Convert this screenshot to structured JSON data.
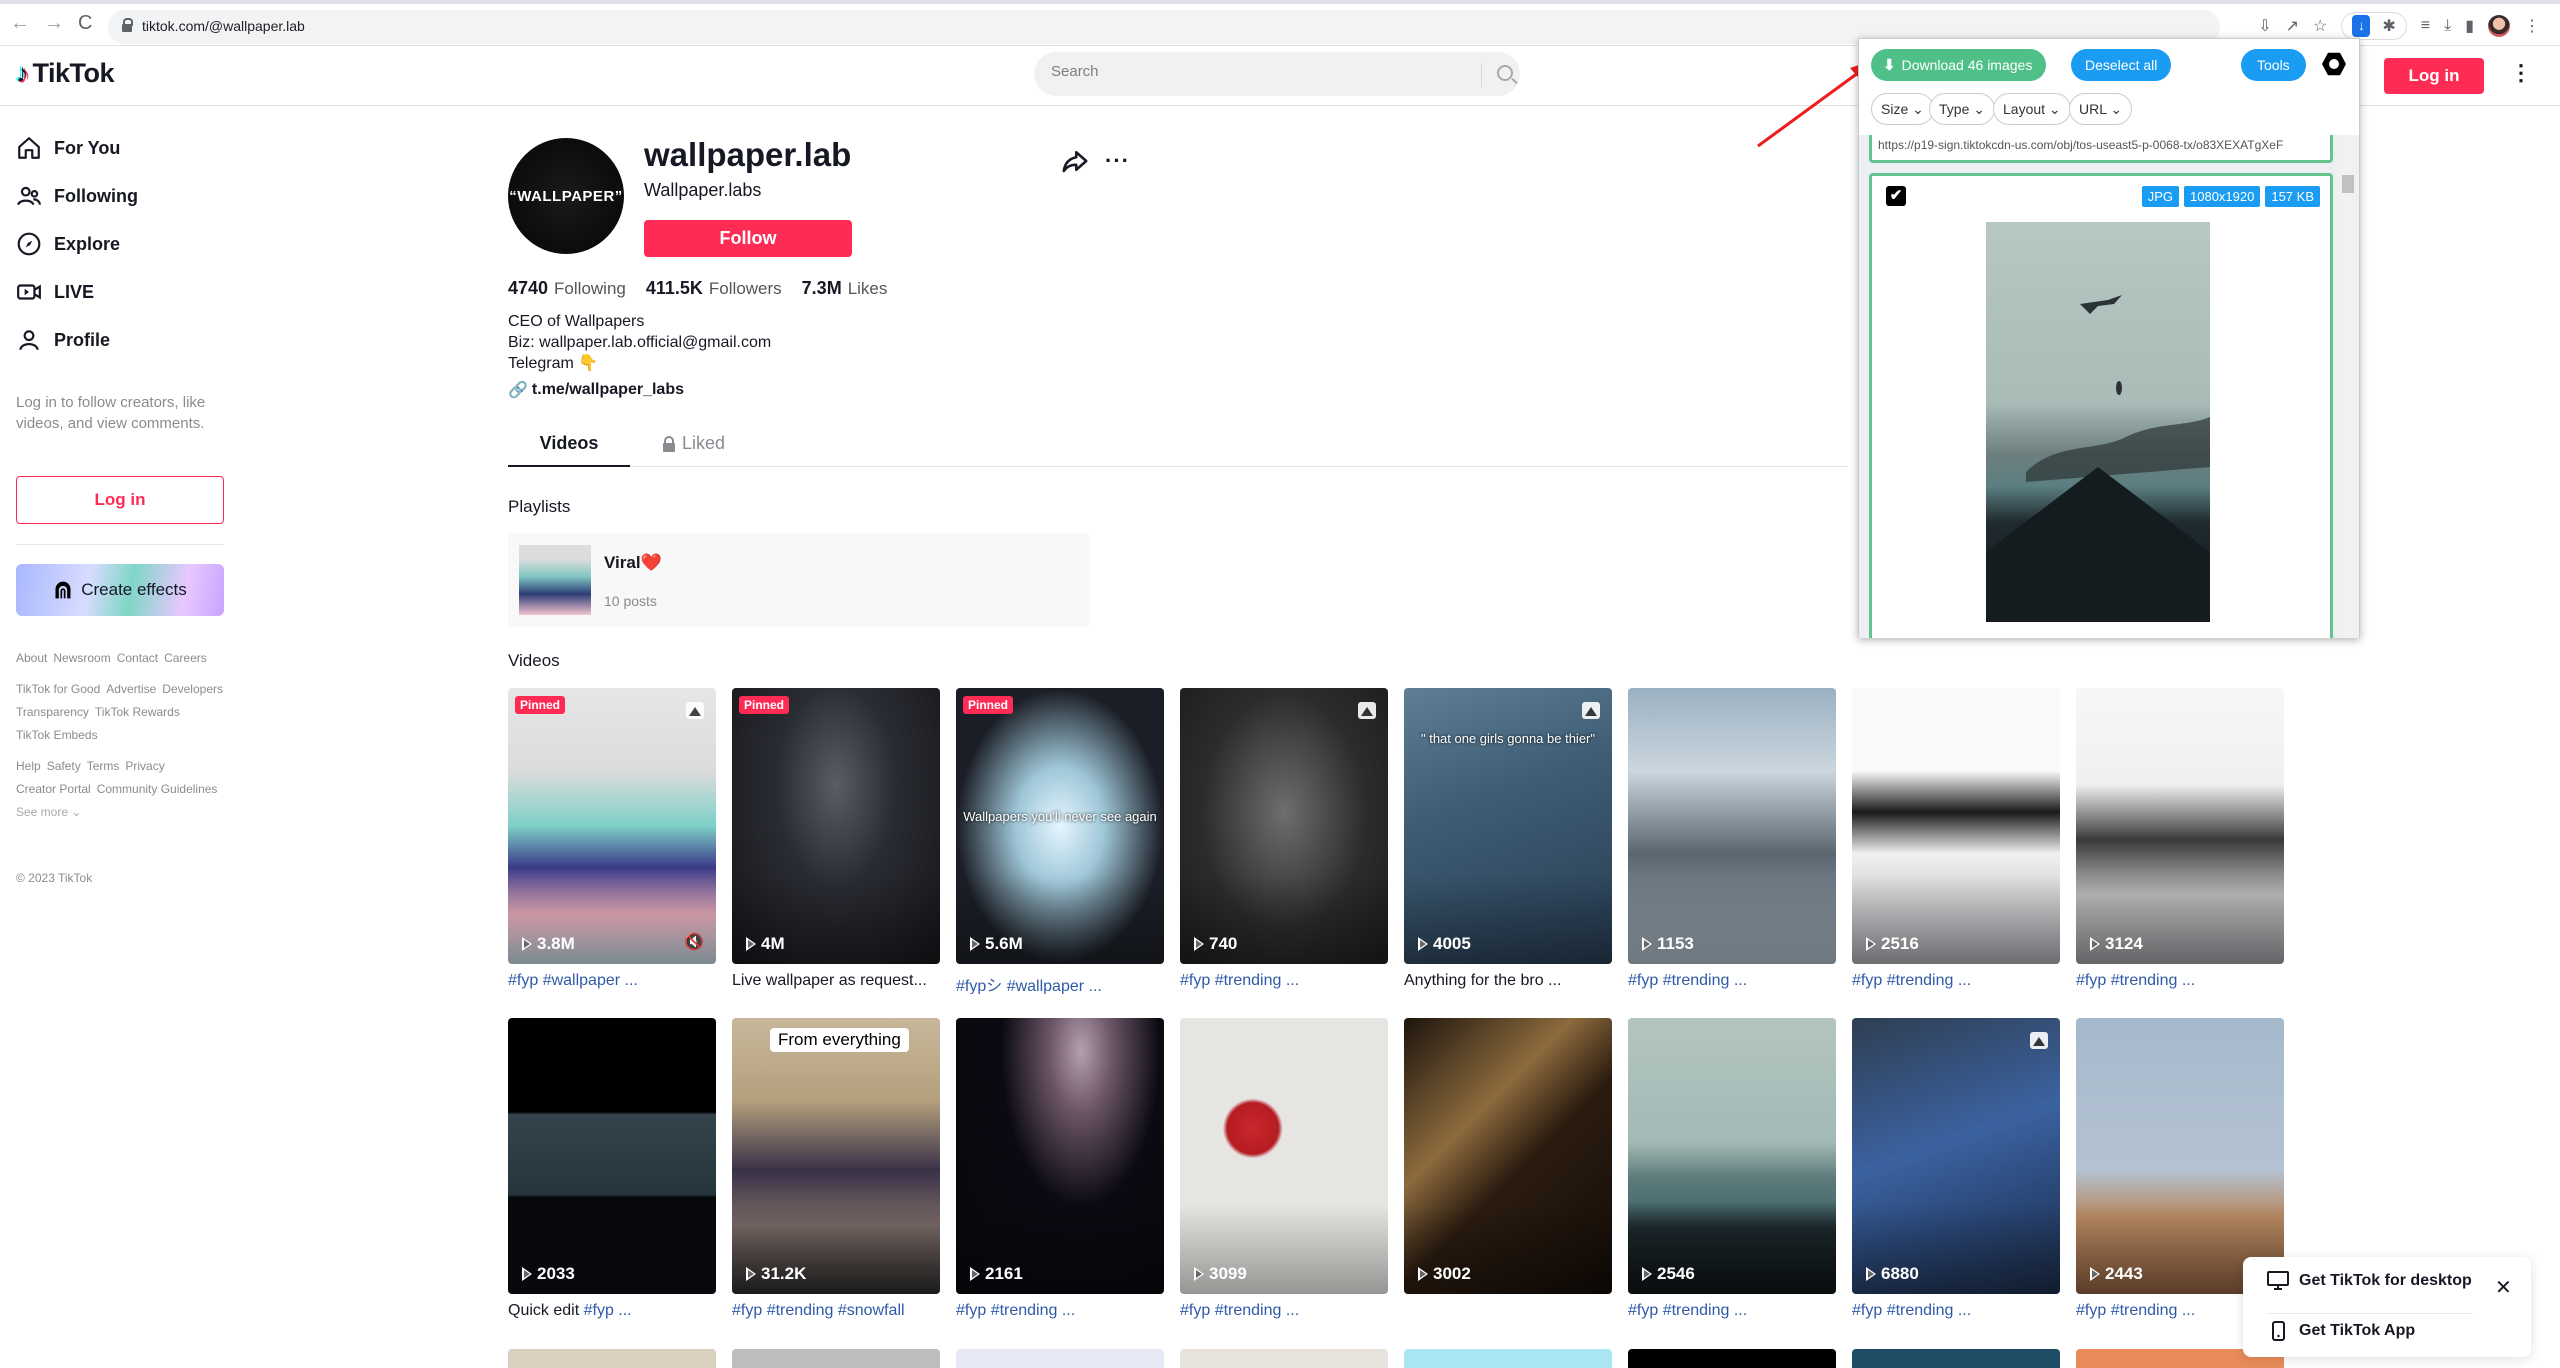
{
  "browser": {
    "url": "tiktok.com/@wallpaper.lab",
    "nav_icons": [
      "back-arrow-icon",
      "forward-arrow-icon",
      "reload-icon"
    ],
    "toolbar_icons": [
      "install-app-icon",
      "share-icon",
      "bookmark-star-icon",
      "image-downloader-extension-icon",
      "extensions-puzzle-icon",
      "reading-list-icon",
      "downloads-icon",
      "side-panel-icon",
      "profile-avatar",
      "menu-kebab-icon"
    ]
  },
  "header": {
    "logo_text": "TikTok",
    "search_placeholder": "Search",
    "login_label": "Log in"
  },
  "sidebar": {
    "items": [
      {
        "label": "For You",
        "icon": "home-icon"
      },
      {
        "label": "Following",
        "icon": "users-icon"
      },
      {
        "label": "Explore",
        "icon": "compass-icon"
      },
      {
        "label": "LIVE",
        "icon": "live-camera-icon"
      },
      {
        "label": "Profile",
        "icon": "person-icon"
      }
    ],
    "login_hint": "Log in to follow creators, like videos, and view comments.",
    "login_label": "Log in",
    "create_effects_label": "Create effects",
    "footer_groups": [
      [
        "About",
        "Newsroom",
        "Contact",
        "Careers"
      ],
      [
        "TikTok for Good",
        "Advertise",
        "Developers",
        "Transparency",
        "TikTok Rewards",
        "TikTok Embeds"
      ],
      [
        "Help",
        "Safety",
        "Terms",
        "Privacy",
        "Creator Portal",
        "Community Guidelines"
      ]
    ],
    "see_more": "See more",
    "copyright": "© 2023 TikTok"
  },
  "profile": {
    "avatar_text": "“WALLPAPER”",
    "username": "wallpaper.lab",
    "nickname": "Wallpaper.labs",
    "follow_label": "Follow",
    "stats": [
      {
        "value": "4740",
        "label": "Following"
      },
      {
        "value": "411.5K",
        "label": "Followers"
      },
      {
        "value": "7.3M",
        "label": "Likes"
      }
    ],
    "bio_lines": [
      "CEO of Wallpapers",
      "Biz: wallpaper.lab.official@gmail.com",
      "Telegram 👇"
    ],
    "link": "t.me/wallpaper_labs",
    "more_label": "···"
  },
  "tabs": [
    {
      "label": "Videos",
      "active": true
    },
    {
      "label": "Liked",
      "locked": true
    }
  ],
  "playlists": {
    "title": "Playlists",
    "items": [
      {
        "name": "Viral❤️",
        "count": "10 posts"
      }
    ]
  },
  "videos": {
    "title": "Videos",
    "items": [
      {
        "views": "3.8M",
        "pinned": true,
        "caption": "#fyp #wallpaper ...",
        "caption_type": "tags",
        "photo": true,
        "muted": true,
        "bg": "linear-gradient(180deg,#e6e6e6 0%,#dcdcdc 30%,#7ed0c8 50%,#3a3a88 65%,#f3b3c3 82%,#bfd4df 100%)"
      },
      {
        "views": "4M",
        "pinned": true,
        "caption": "Live wallpaper as request...",
        "caption_type": "plain",
        "bg": "radial-gradient(ellipse at 50% 35%,#5a5d66 0%,#2a2c33 40%,#141519 100%)"
      },
      {
        "views": "5.6M",
        "pinned": true,
        "caption": "#fypシ #wallpaper ...",
        "caption_type": "tags",
        "overlay": "Wallpapers you'll never see again",
        "bg": "radial-gradient(ellipse at 50% 50%,#e6f6ff 0%,#9fc7d8 30%,#1b1e26 70%)"
      },
      {
        "views": "740",
        "caption": "#fyp #trending ...",
        "caption_type": "tags",
        "photo": true,
        "bg": "radial-gradient(ellipse at 50% 45%,#6e6e6e 0%,#2c2c2c 55%,#1c1c1c 100%)"
      },
      {
        "views": "4005",
        "caption": "Anything for the bro ...",
        "caption_type": "plain",
        "photo": true,
        "overlay": "\" that one girls gonna be thier\"",
        "bg": "linear-gradient(160deg,#5f7f96 0%,#3e5d75 40%,#263a4f 100%)"
      },
      {
        "views": "1153",
        "caption": "#fyp #trending ...",
        "caption_type": "tags",
        "bg": "linear-gradient(180deg,#9ab0c2 0%,#cbd6de 30%,#5a6670 60%,#a9b8c4 100%)"
      },
      {
        "views": "2516",
        "caption": "#fyp #trending ...",
        "caption_type": "tags",
        "bg": "linear-gradient(180deg,#fafafa 0%,#fafafa 30%,#1a1a1a 45%,#f0f0f0 60%,#a8a9ae 100%)"
      },
      {
        "views": "3124",
        "caption": "#fyp #trending ...",
        "caption_type": "tags",
        "bg": "linear-gradient(180deg,#f7f7f7 0%,#f0f0f0 35%,#3a3a3a 55%,#bdbdbd 75%,#9b9ca1 100%)"
      },
      {
        "views": "2033",
        "caption_plain": "Quick edit ",
        "caption": "#fyp ...",
        "caption_type": "mixed",
        "bg": "linear-gradient(180deg,#000 0%,#000 34%,#35444c 35%,#26343c 64%,#05070a 65%,#0b0d12 100%)"
      },
      {
        "views": "31.2K",
        "caption": "#fyp #trending #snowfall",
        "caption_type": "tags",
        "overlay_box": "From everything",
        "bg": "linear-gradient(180deg,#c7b79a 0%,#b4a07d 30%,#3a3148 55%,#7a6a66 75%,#2a2a2a 100%)"
      },
      {
        "views": "2161",
        "caption": "#fyp #trending ...",
        "caption_type": "tags",
        "bg": "radial-gradient(ellipse at 60% 12%,#b5a0b0 0%,#6b5566 18%,#0b0a12 45%,#07070c 100%)"
      },
      {
        "views": "3099",
        "caption": "#fyp #trending ...",
        "caption_type": "tags",
        "bg": "radial-gradient(circle at 35% 40%,#c8282c 0%,#b51c22 12%,#e6e5e2 14%,#e6e5e2 100%)"
      },
      {
        "views": "3002",
        "caption": "",
        "caption_type": "none",
        "bg": "linear-gradient(135deg,#1d140d 0%,#8c6a3d 35%,#2b1c10 55%,#120b07 100%)"
      },
      {
        "views": "2546",
        "caption": "#fyp #trending ...",
        "caption_type": "tags",
        "bg": "linear-gradient(180deg,#b3c5c1 0%,#a3b9b5 45%,#5d7b7b 58%,#4e7173 66%,#1d282c 76%,#0d1416 100%)"
      },
      {
        "views": "6880",
        "caption": "#fyp #trending ...",
        "caption_type": "tags",
        "photo": true,
        "bg": "linear-gradient(160deg,#2f3e52 0%,#3b62a0 45%,#2a4777 70%,#1b2a45 100%)"
      },
      {
        "views": "2443",
        "caption": "#fyp #trending ...",
        "caption_type": "tags",
        "bg": "linear-gradient(180deg,#a6b9cc 0%,#b3c2d2 55%,#b88a62 72%,#8d5e40 100%)"
      }
    ],
    "next_row_colors": [
      "#d9d0c0",
      "#bdbdbd",
      "#e6e8f6",
      "#e8e4dd",
      "#a9e6f2",
      "#000000",
      "#1f4d66",
      "#e98c5a"
    ]
  },
  "extension_popup": {
    "download_label": "Download 46 images",
    "deselect_label": "Deselect all",
    "tools_label": "Tools",
    "filters": [
      "Size",
      "Type",
      "Layout",
      "URL"
    ],
    "url_preview": "https://p19-sign.tiktokcdn-us.com/obj/tos-useast5-p-0068-tx/o83XEXATgXeF",
    "image_card": {
      "checked": true,
      "badges": [
        "JPG",
        "1080x1920",
        "157 KB"
      ]
    }
  },
  "get_app": {
    "desktop_label": "Get TikTok for desktop",
    "app_label": "Get TikTok App"
  },
  "colors": {
    "brand": "#fe2c55",
    "download_green": "#4fc188",
    "extension_blue": "#1a9cf2",
    "hashtag_blue": "#2f5aa8"
  }
}
